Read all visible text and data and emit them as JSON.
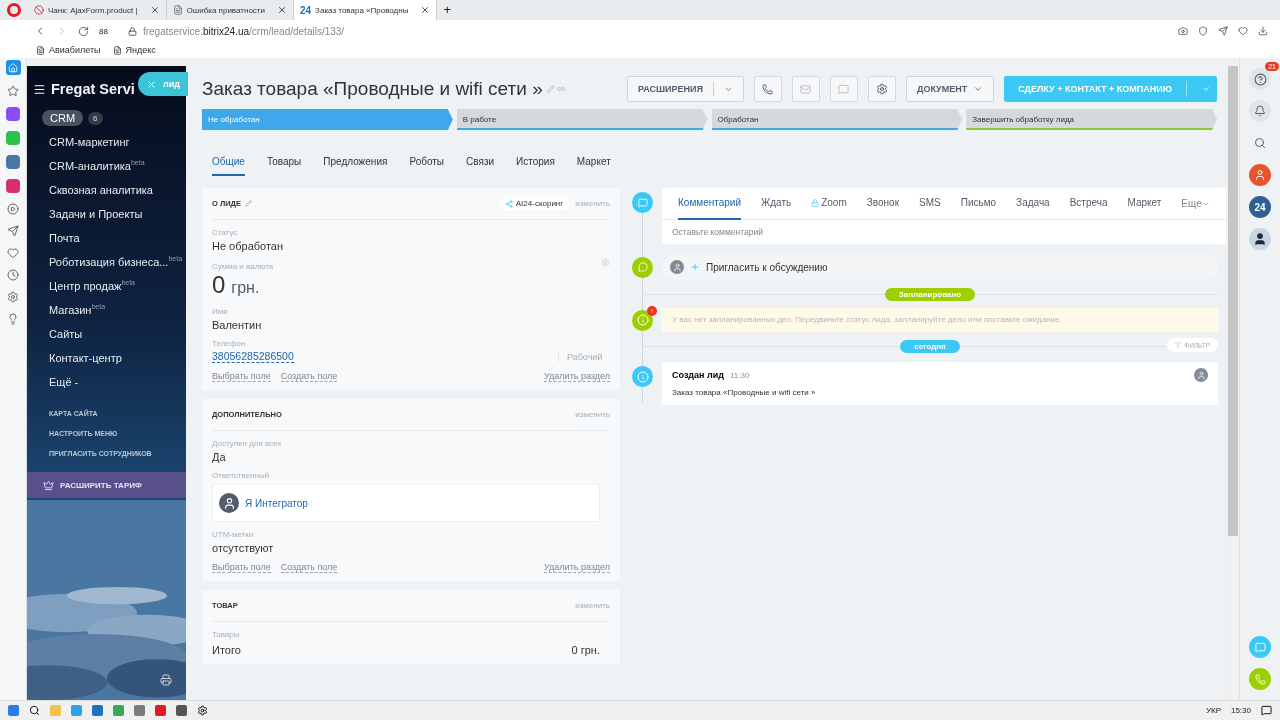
{
  "browser": {
    "tabs": [
      {
        "title": "Чанк: AjaxForm.product | ",
        "kind": "error",
        "selected": false
      },
      {
        "title": "Ошибка приватности",
        "kind": "page",
        "selected": false
      },
      {
        "title": "Заказ товара «Проводны",
        "kind": "bitrix",
        "icon_text": "24",
        "selected": true
      }
    ],
    "new_tab": "+",
    "speed_dial": "88",
    "url_host": "fregatservice.",
    "url_domain": "bitrix24.ua",
    "url_path": "/crm/lead/details/133/",
    "bookmarks": [
      "Авиабилеты",
      "Яндекс"
    ]
  },
  "menu": {
    "brand": "Fregat Servi",
    "close_label": "лид",
    "crm": {
      "label": "CRM",
      "count": "6",
      "selected": true
    },
    "items": [
      {
        "label": "CRM-маркетинг",
        "selected": false
      },
      {
        "label": "CRM-аналитика",
        "badge": "beta",
        "selected": false
      },
      {
        "label": "Сквозная аналитика",
        "selected": false
      },
      {
        "label": "Задачи и Проекты",
        "selected": false
      },
      {
        "label": "Почта",
        "selected": false
      },
      {
        "label": "Роботизация бизнеса...",
        "badge": "beta",
        "selected": false
      },
      {
        "label": "Центр продаж",
        "badge": "beta",
        "selected": false
      },
      {
        "label": "Магазин",
        "badge": "beta",
        "selected": false
      },
      {
        "label": "Сайты",
        "selected": false
      },
      {
        "label": "Контакт-центр",
        "selected": false
      },
      {
        "label": "Ещё -",
        "selected": false
      }
    ],
    "links": [
      "КАРТА САЙТА",
      "НАСТРОИТЬ МЕНЮ",
      "ПРИГЛАСИТЬ СОТРУДНИКОВ"
    ],
    "upgrade": "РАСШИРИТЬ ТАРИФ"
  },
  "header": {
    "title": "Заказ товара «Проводные и wifi сети »",
    "extensions": "РАСШИРЕНИЯ",
    "document": "ДОКУМЕНТ",
    "convert": "СДЕЛКУ + КОНТАКТ + КОМПАНИЮ"
  },
  "stages": [
    {
      "label": "Не обработан",
      "selected": true,
      "color": "#3fa8ec"
    },
    {
      "label": "В работе",
      "selected": false,
      "color": "#3fa8ec"
    },
    {
      "label": "Обработан",
      "selected": false,
      "color": "#3fa8ec"
    },
    {
      "label": "Завершить обработку лида",
      "selected": false,
      "color": "#8fc93a"
    }
  ],
  "tabs": [
    {
      "label": "Общие",
      "selected": true
    },
    {
      "label": "Товары",
      "selected": false
    },
    {
      "label": "Предложения",
      "selected": false
    },
    {
      "label": "Роботы",
      "selected": false
    },
    {
      "label": "Связи",
      "selected": false
    },
    {
      "label": "История",
      "selected": false
    },
    {
      "label": "Маркет",
      "selected": false
    }
  ],
  "sections": [
    {
      "title": "О ЛИДЕ",
      "editable": true,
      "badge": "AI24-скоринг",
      "action": "изменить",
      "fields": [
        {
          "kind": "text",
          "label": "Статус",
          "value": "Не обработан"
        },
        {
          "kind": "money",
          "label": "Сумма и валюта",
          "value": "0",
          "currency": "грн."
        },
        {
          "kind": "text",
          "label": "Имя",
          "value": "Валентин"
        },
        {
          "kind": "phone",
          "label": "Телефон",
          "value": "38056285286500",
          "type": "Рабочий"
        }
      ],
      "footer": [
        "Выбрать поле",
        "Создать поле",
        "Удалить раздел"
      ]
    },
    {
      "title": "ДОПОЛНИТЕЛЬНО",
      "editable": false,
      "action": "изменить",
      "fields": [
        {
          "kind": "text",
          "label": "Доступен для всех",
          "value": "Да"
        },
        {
          "kind": "user",
          "label": "Ответственный",
          "value": "Я Интегратор"
        },
        {
          "kind": "text",
          "label": "UTM-метки",
          "value": "отсутствуют"
        }
      ],
      "footer": [
        "Выбрать поле",
        "Создать поле",
        "Удалить раздел"
      ]
    },
    {
      "title": "ТОВАР",
      "editable": false,
      "action": "изменить",
      "fields": [
        {
          "kind": "total",
          "label": "Товары",
          "value": "Итого",
          "amount": "0 грн."
        }
      ]
    }
  ],
  "timeline": {
    "composer_tabs": [
      {
        "label": "Комментарий",
        "selected": true,
        "locked": false
      },
      {
        "label": "Ждать",
        "selected": false,
        "locked": false
      },
      {
        "label": "Zoom",
        "selected": false,
        "locked": true
      },
      {
        "label": "Звонок",
        "selected": false,
        "locked": false
      },
      {
        "label": "SMS",
        "selected": false,
        "locked": false
      },
      {
        "label": "Письмо",
        "selected": false,
        "locked": false
      },
      {
        "label": "Задача",
        "selected": false,
        "locked": false
      },
      {
        "label": "Встреча",
        "selected": false,
        "locked": false
      },
      {
        "label": "Маркет",
        "selected": false,
        "locked": false
      }
    ],
    "more": "Еще",
    "placeholder": "Оставьте комментарий",
    "invite": "Пригласить к обсуждению",
    "planned_label": "Запланировано",
    "notice_badge": "!",
    "notice": "У вас нет запланированных дел. Передвиньте статус лида, запланируйте дело или поставьте ожидание.",
    "today_label": "сегодня",
    "filter": "ФИЛЬТР",
    "event": {
      "title": "Создан лид",
      "time": "11:30",
      "text": "Заказ товара «Проводные и wifi сети »"
    }
  },
  "right_panel": {
    "help_count": "21",
    "avatar_text": "24"
  },
  "taskbar": {
    "language": "УКР",
    "time": "15:30"
  }
}
